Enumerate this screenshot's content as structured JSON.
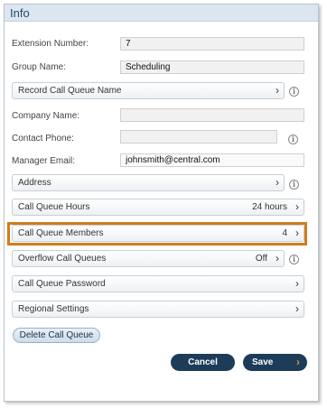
{
  "header": {
    "title": "Info"
  },
  "fields": {
    "extension_number": {
      "label": "Extension Number:",
      "value": "7"
    },
    "group_name": {
      "label": "Group Name:",
      "value": "Scheduling"
    },
    "company_name": {
      "label": "Company Name:",
      "value": ""
    },
    "contact_phone": {
      "label": "Contact Phone:",
      "value": ""
    },
    "manager_email": {
      "label": "Manager Email:",
      "value": "johnsmith@central.com"
    }
  },
  "rows": {
    "record_name": {
      "label": "Record Call Queue Name"
    },
    "address": {
      "label": "Address"
    },
    "hours": {
      "label": "Call Queue Hours",
      "value": "24 hours"
    },
    "members": {
      "label": "Call Queue Members",
      "value": "4"
    },
    "overflow": {
      "label": "Overflow Call Queues",
      "value": "Off"
    },
    "password": {
      "label": "Call Queue Password"
    },
    "regional": {
      "label": "Regional Settings"
    }
  },
  "buttons": {
    "delete_label": "Delete Call Queue",
    "cancel_label": "Cancel",
    "save_label": "Save"
  },
  "icons": {
    "chevron": "›",
    "info": "i"
  },
  "colors": {
    "highlight": "#d07d1c",
    "primary_button": "#1c3c5a",
    "header_bg": "#dce6f0"
  }
}
